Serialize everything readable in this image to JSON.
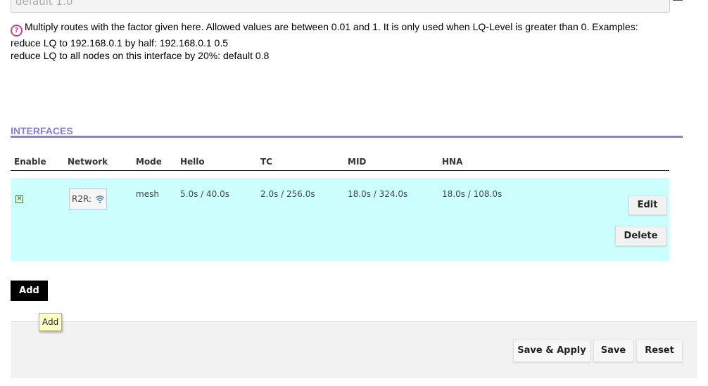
{
  "top_field": {
    "placeholder": "default 1.0"
  },
  "help": {
    "icon": "help-circle-icon",
    "icon_glyph": "?",
    "line1": "Multiply routes with the factor given here. Allowed values are between 0.01 and 1. It is only used when LQ-Level is greater than 0. Examples:",
    "line2": "reduce LQ to 192.168.0.1 by half: 192.168.0.1 0.5",
    "line3": "reduce LQ to all nodes on this interface by 20%: default 0.8"
  },
  "section": {
    "title": "INTERFACES",
    "accent_color": "#8a7cd0"
  },
  "table": {
    "columns": [
      "Enable",
      "Network",
      "Mode",
      "Hello",
      "TC",
      "MID",
      "HNA"
    ],
    "rows": [
      {
        "enabled": true,
        "enabled_glyph": "✕",
        "network": "R2R:",
        "network_icon": "wifi-icon",
        "mode": "mesh",
        "hello": "5.0s / 40.0s",
        "tc": "2.0s / 256.0s",
        "mid": "18.0s / 324.0s",
        "hna": "18.0s / 108.0s",
        "edit_label": "Edit",
        "delete_label": "Delete"
      }
    ],
    "row_color": "#ccffff"
  },
  "add_button": {
    "label": "Add",
    "tooltip": "Add"
  },
  "footer": {
    "save_apply_label": "Save & Apply",
    "save_label": "Save",
    "reset_label": "Reset"
  }
}
